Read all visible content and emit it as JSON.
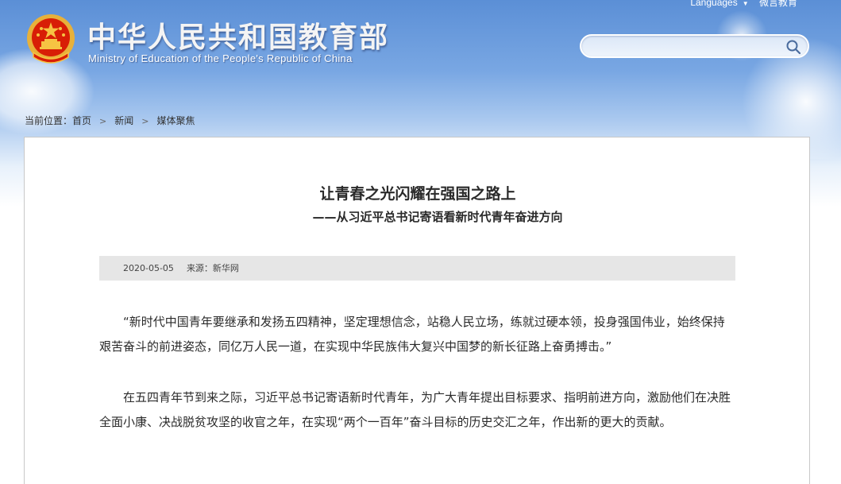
{
  "header": {
    "title": "中华人民共和国教育部",
    "subtitle": "Ministry of Education of the People's Republic of China",
    "languages_label": "Languages",
    "weibo_label": "微言教育"
  },
  "search": {
    "placeholder": ""
  },
  "breadcrumb": {
    "prefix": "当前位置：",
    "home": "首页",
    "news": "新闻",
    "current": "媒体聚焦",
    "separator": ">"
  },
  "article": {
    "title": "让青春之光闪耀在强国之路上",
    "subtitle": "——从习近平总书记寄语看新时代青年奋进方向",
    "date": "2020-05-05",
    "source": "来源：新华网",
    "paragraphs": [
      "“新时代中国青年要继承和发扬五四精神，坚定理想信念，站稳人民立场，练就过硬本领，投身强国伟业，始终保持艰苦奋斗的前进姿态，同亿万人民一道，在实现中华民族伟大复兴中国梦的新长征路上奋勇搏击。”",
      "在五四青年节到来之际，习近平总书记寄语新时代青年，为广大青年提出目标要求、指明前进方向，激励他们在决胜全面小康、决战脱贫攻坚的收官之年，在实现“两个一百年”奋斗目标的历史交汇之年，作出新的更大的贡献。"
    ]
  },
  "colors": {
    "header_sky": "#5b8fd6",
    "emblem_red": "#d81e06",
    "emblem_gold": "#f6c343",
    "meta_bar": "#e6e6e6"
  },
  "icons": {
    "emblem": "national-emblem-icon",
    "search": "search-icon",
    "breadcrumb_separator": "chevron-right-icon",
    "languages_dropdown": "caret-down-icon"
  }
}
